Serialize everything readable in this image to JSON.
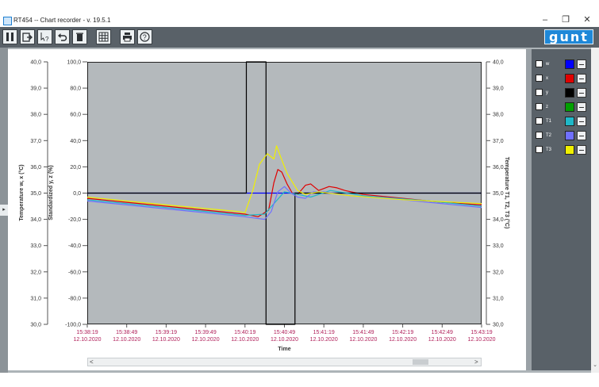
{
  "window": {
    "title": "RT454  --  Chart recorder - v. 19.5.1",
    "minimize_glyph": "–",
    "restore_glyph": "❐",
    "close_glyph": "✕"
  },
  "toolbar": {
    "buttons": [
      {
        "name": "pause-button",
        "icon": "pause-icon"
      },
      {
        "name": "export-button",
        "icon": "export-icon"
      },
      {
        "name": "help-cursor-button",
        "icon": "help-cursor-icon"
      },
      {
        "name": "undo-button",
        "icon": "undo-icon"
      },
      {
        "name": "delete-button",
        "icon": "trash-icon"
      },
      {
        "name": "grid-button",
        "icon": "grid-icon"
      },
      {
        "name": "print-button",
        "icon": "printer-icon"
      },
      {
        "name": "help-button",
        "icon": "question-icon"
      }
    ],
    "logo_text": "gunt"
  },
  "chart_data": {
    "type": "line",
    "xlabel": "Time",
    "x_ticks": [
      {
        "time": "15:38:19",
        "date": "12.10.2020"
      },
      {
        "time": "15:38:49",
        "date": "12.10.2020"
      },
      {
        "time": "15:39:19",
        "date": "12.10.2020"
      },
      {
        "time": "15:39:49",
        "date": "12.10.2020"
      },
      {
        "time": "15:40:19",
        "date": "12.10.2020"
      },
      {
        "time": "15:40:49",
        "date": "12.10.2020"
      },
      {
        "time": "15:41:19",
        "date": "12.10.2020"
      },
      {
        "time": "15:41:49",
        "date": "12.10.2020"
      },
      {
        "time": "15:42:19",
        "date": "12.10.2020"
      },
      {
        "time": "15:42:49",
        "date": "12.10.2020"
      },
      {
        "time": "15:43:19",
        "date": "12.10.2020"
      }
    ],
    "xlim_seconds_from_first_tick": [
      0,
      300
    ],
    "axes": {
      "left_temperature": {
        "label_parts": [
          "Temperature",
          "w, x",
          "(°C)"
        ],
        "ticks": [
          "40,0",
          "39,0",
          "38,0",
          "37,0",
          "36,0",
          "35,0",
          "34,0",
          "33,0",
          "32,0",
          "31,0",
          "30,0"
        ],
        "ylim": [
          30,
          40
        ]
      },
      "left_standardized": {
        "label_parts": [
          "Standardized",
          "y, z",
          "(%)"
        ],
        "ticks": [
          "100,0",
          "80,0",
          "60,0",
          "40,0",
          "20,0",
          "0,0",
          "-20,0",
          "-40,0",
          "-60,0",
          "-80,0",
          "-100,0"
        ],
        "ylim": [
          -100,
          100
        ]
      },
      "right_temperature": {
        "label_parts": [
          "Temperature",
          "T1, T2, T3",
          "(°C)"
        ],
        "ticks": [
          "40,0",
          "39,0",
          "38,0",
          "37,0",
          "36,0",
          "35,0",
          "34,0",
          "33,0",
          "32,0",
          "31,0",
          "30,0"
        ],
        "ylim": [
          30,
          40
        ]
      }
    },
    "grid": false,
    "series": [
      {
        "name": "w",
        "axis": "temperature",
        "color": "#0000ff",
        "points": [
          [
            0,
            35.0
          ],
          [
            300,
            35.0
          ]
        ]
      },
      {
        "name": "x",
        "axis": "temperature",
        "color": "#e00000",
        "points": [
          [
            0,
            34.8
          ],
          [
            30,
            34.65
          ],
          [
            60,
            34.5
          ],
          [
            90,
            34.35
          ],
          [
            120,
            34.2
          ],
          [
            130,
            34.1
          ],
          [
            138,
            34.35
          ],
          [
            142,
            35.4
          ],
          [
            145,
            35.9
          ],
          [
            148,
            35.8
          ],
          [
            152,
            35.35
          ],
          [
            156,
            35.0
          ],
          [
            160,
            34.95
          ],
          [
            166,
            35.3
          ],
          [
            170,
            35.35
          ],
          [
            176,
            35.1
          ],
          [
            184,
            35.25
          ],
          [
            190,
            35.2
          ],
          [
            196,
            35.1
          ],
          [
            210,
            34.95
          ],
          [
            240,
            34.8
          ],
          [
            270,
            34.65
          ],
          [
            300,
            34.55
          ]
        ]
      },
      {
        "name": "y",
        "axis": "standardized",
        "color": "#000000",
        "points": [
          [
            0,
            0
          ],
          [
            121,
            0
          ],
          [
            121,
            100
          ],
          [
            136,
            100
          ],
          [
            136,
            -100
          ],
          [
            158,
            -100
          ],
          [
            158,
            0
          ],
          [
            300,
            0
          ]
        ]
      },
      {
        "name": "T1",
        "axis": "temperature",
        "color": "#1fb8c8",
        "points": [
          [
            0,
            34.75
          ],
          [
            60,
            34.45
          ],
          [
            120,
            34.15
          ],
          [
            135,
            34.2
          ],
          [
            150,
            35.05
          ],
          [
            170,
            34.85
          ],
          [
            185,
            35.1
          ],
          [
            210,
            34.9
          ],
          [
            260,
            34.7
          ],
          [
            300,
            34.5
          ]
        ]
      },
      {
        "name": "T2",
        "axis": "temperature",
        "color": "#7070ff",
        "points": [
          [
            0,
            34.7
          ],
          [
            30,
            34.55
          ],
          [
            60,
            34.4
          ],
          [
            90,
            34.25
          ],
          [
            120,
            34.1
          ],
          [
            135,
            34.0
          ],
          [
            140,
            34.3
          ],
          [
            145,
            35.05
          ],
          [
            150,
            35.25
          ],
          [
            155,
            35.0
          ],
          [
            160,
            34.85
          ],
          [
            166,
            34.8
          ],
          [
            172,
            35.05
          ],
          [
            180,
            35.05
          ],
          [
            200,
            34.9
          ],
          [
            230,
            34.8
          ],
          [
            260,
            34.65
          ],
          [
            300,
            34.45
          ]
        ]
      },
      {
        "name": "T3",
        "axis": "temperature",
        "color": "#f0f000",
        "points": [
          [
            0,
            34.85
          ],
          [
            60,
            34.55
          ],
          [
            115,
            34.3
          ],
          [
            120,
            34.25
          ],
          [
            126,
            35.1
          ],
          [
            131,
            36.1
          ],
          [
            137,
            36.5
          ],
          [
            142,
            36.3
          ],
          [
            144,
            36.8
          ],
          [
            147,
            36.4
          ],
          [
            152,
            35.75
          ],
          [
            160,
            35.1
          ],
          [
            166,
            34.95
          ],
          [
            176,
            35.05
          ],
          [
            200,
            34.9
          ],
          [
            240,
            34.75
          ],
          [
            300,
            34.6
          ]
        ]
      }
    ]
  },
  "legend": {
    "items": [
      {
        "label": "w",
        "color": "#0000ff"
      },
      {
        "label": "x",
        "color": "#e00000"
      },
      {
        "label": "y",
        "color": "#000000"
      },
      {
        "label": "z",
        "color": "#00a000"
      },
      {
        "label": "T1",
        "color": "#1fb8c8"
      },
      {
        "label": "T2",
        "color": "#7070ff"
      },
      {
        "label": "T3",
        "color": "#f0f000"
      }
    ]
  },
  "scrollbar": {
    "left_arrow": "<",
    "right_arrow": ">"
  }
}
